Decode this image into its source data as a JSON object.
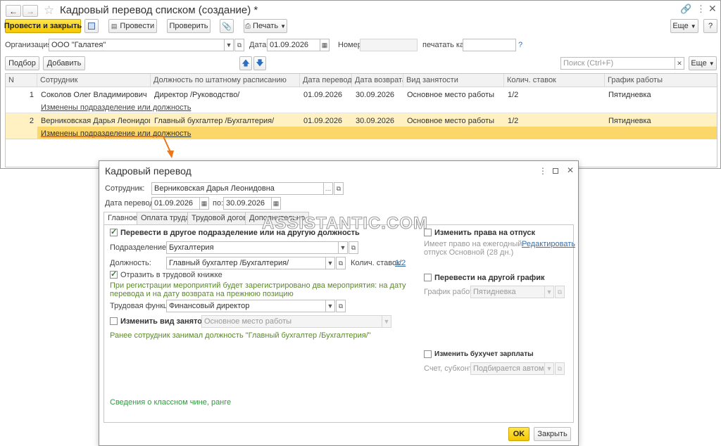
{
  "main": {
    "title": "Кадровый перевод списком (создание) *",
    "toolbar": {
      "post_close": "Провести и закрыть",
      "post": "Провести",
      "check": "Проверить",
      "print": "Печать",
      "more": "Еще",
      "help": "?"
    },
    "org": {
      "label": "Организация:",
      "value": "ООО \"Галатея\"",
      "date_label": "Дата:",
      "date_value": "01.09.2026",
      "number_label": "Номер:",
      "number_value": "",
      "print_as_label": "печатать как:",
      "print_as_value": "",
      "help": "?"
    },
    "list_toolbar": {
      "pick": "Подбор",
      "add": "Добавить",
      "search_placeholder": "Поиск (Ctrl+F)",
      "more": "Еще"
    },
    "table": {
      "headers": [
        "N",
        "Сотрудник",
        "Должность по штатному расписанию",
        "Дата перевода",
        "Дата возврата",
        "Вид занятости",
        "Колич. ставок",
        "График работы"
      ],
      "rows": [
        {
          "n": "1",
          "employee": "Соколов Олег Владимирович",
          "position": "Директор /Руководство/",
          "date_transfer": "01.09.2026",
          "date_return": "30.09.2026",
          "employment": "Основное место работы",
          "rates": "1/2",
          "schedule": "Пятидневка",
          "note": "Изменены подразделение или должность"
        },
        {
          "n": "2",
          "employee": "Верниковская Дарья Леонидовна",
          "position": "Главный бухгалтер /Бухгалтерия/",
          "date_transfer": "01.09.2026",
          "date_return": "30.09.2026",
          "employment": "Основное место работы",
          "rates": "1/2",
          "schedule": "Пятидневка",
          "note": "Изменены подразделение или должность"
        }
      ]
    }
  },
  "dialog": {
    "title": "Кадровый перевод",
    "employee_label": "Сотрудник:",
    "employee_value": "Верниковская Дарья Леонидовна",
    "date_label": "Дата перевода:",
    "date_from": "01.09.2026",
    "date_to_label": "по:",
    "date_to": "30.09.2026",
    "tabs": [
      "Главное",
      "Оплата труда",
      "Трудовой договор",
      "Дополнительно"
    ],
    "transfer_checkbox": "Перевести в другое подразделение или на другую должность",
    "subdivision_label": "Подразделение:",
    "subdivision_value": "Бухгалтерия",
    "position_label": "Должность:",
    "position_value": "Главный бухгалтер /Бухгалтерия/",
    "rates_label": "Колич. ставок:",
    "rates_value": "1/2",
    "workbook_checkbox": "Отразить в трудовой книжке",
    "info_text_1": "При регистрации мероприятий будет зарегистрировано два мероприятия: на дату",
    "info_text_2": "перевода и на дату возврата на прежнюю позицию",
    "labor_function_label": "Трудовая функция:",
    "labor_function_value": "Финансовый директор",
    "change_employment_checkbox": "Изменить вид занятости",
    "employment_value": "Основное место работы",
    "previous_position_text": "Ранее сотрудник занимал должность \"Главный бухгалтер /Бухгалтерия/\"",
    "class_rank_link": "Сведения о классном чине, ранге",
    "vacation_checkbox": "Изменить права на отпуск",
    "vacation_info_1": "Имеет право на ежегодный",
    "vacation_info_2": "отпуск Основной (28 дн.)",
    "edit_link": "Редактировать",
    "schedule_checkbox": "Перевести на другой график",
    "schedule_label": "График работы:",
    "schedule_value": "Пятидневка",
    "accounting_checkbox": "Изменить бухучет зарплаты",
    "account_label": "Счет, субконто:",
    "account_value": "Подбирается автомати...",
    "ok": "OK",
    "close": "Закрыть"
  },
  "watermark": "ASSISTANTIC.COM",
  "colors": {
    "accent_yellow": "#f5c800",
    "selected_row": "#fff1c2",
    "link": "#3a6ea5",
    "green_text": "#5b8a2a",
    "arrow_orange": "#e8771e"
  }
}
